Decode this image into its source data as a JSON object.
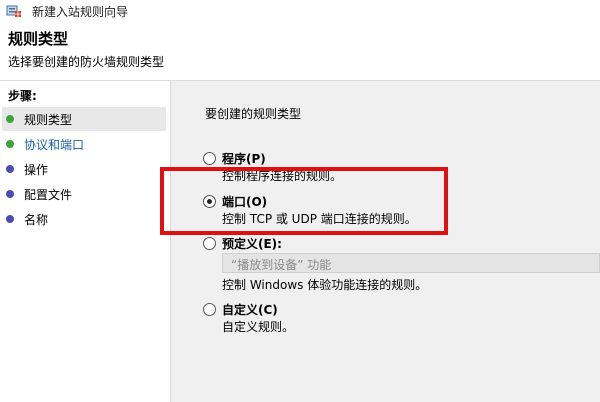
{
  "window": {
    "title": "新建入站规则向导",
    "icon": "firewall-wizard-icon"
  },
  "header": {
    "title": "规则类型",
    "subtitle": "选择要创建的防火墙规则类型"
  },
  "sidebar": {
    "steps_label": "步骤:",
    "steps": [
      {
        "label": "规则类型",
        "dot_color": "#3aa63a",
        "active": true
      },
      {
        "label": "协议和端口",
        "dot_color": "#3aa63a",
        "active": false
      },
      {
        "label": "操作",
        "dot_color": "#4b4bb4",
        "active": false
      },
      {
        "label": "配置文件",
        "dot_color": "#4b4bb4",
        "active": false
      },
      {
        "label": "名称",
        "dot_color": "#4b4bb4",
        "active": false
      }
    ]
  },
  "main": {
    "question": "要创建的规则类型",
    "options": [
      {
        "label": "程序(P)",
        "desc": "控制程序连接的规则。",
        "selected": false
      },
      {
        "label": "端口(O)",
        "desc": "控制 TCP 或 UDP 端口连接的规则。",
        "selected": true
      },
      {
        "label": "预定义(E):",
        "select_value": "“播放到设备” 功能",
        "desc": "控制 Windows 体验功能连接的规则。",
        "selected": false
      },
      {
        "label": "自定义(C)",
        "desc": "自定义规则。",
        "selected": false
      }
    ]
  },
  "colors": {
    "highlight": "#e01010",
    "link_step": "#1a5fa8"
  }
}
